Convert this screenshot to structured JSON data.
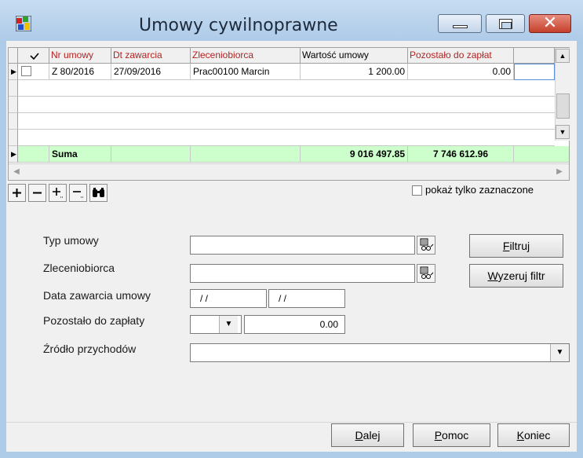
{
  "window": {
    "title": "Umowy cywilnoprawne"
  },
  "grid": {
    "columns": [
      "Nr umowy",
      "Dt zawarcia",
      "Zleceniobiorca",
      "Wartość umowy",
      "Pozostało do zapłat"
    ],
    "rows": [
      {
        "checked": false,
        "nr": "Z 80/2016",
        "date": "27/09/2016",
        "contractor": "Prac00100 Marcin",
        "value": "1 200.00",
        "remaining": "0.00"
      }
    ],
    "sum": {
      "label": "Suma",
      "value": "9 016 497.85",
      "remaining": "7 746 612.96"
    }
  },
  "toolbar": {
    "icons": [
      "plus-icon",
      "minus-icon",
      "plus-multi-icon",
      "minus-multi-icon",
      "binoculars-icon"
    ],
    "show_only_checked_label": "pokaż tylko zaznaczone"
  },
  "filters": {
    "type_label": "Typ umowy",
    "contractor_label": "Zleceniobiorca",
    "date_label": "Data zawarcia umowy",
    "date_from": "/ /",
    "date_to": "/ /",
    "remaining_label": "Pozostało do zapłaty",
    "remaining_value": "0.00",
    "source_label": "Źródło przychodów",
    "filter_button": {
      "accel": "F",
      "rest": "iltruj"
    },
    "reset_button": {
      "accel": "W",
      "rest": "yzeruj filtr"
    }
  },
  "footer": {
    "next_button": {
      "accel": "D",
      "rest": "alej"
    },
    "help_button": {
      "accel": "P",
      "rest": "omoc"
    },
    "end_button": {
      "accel": "K",
      "rest": "oniec"
    }
  }
}
